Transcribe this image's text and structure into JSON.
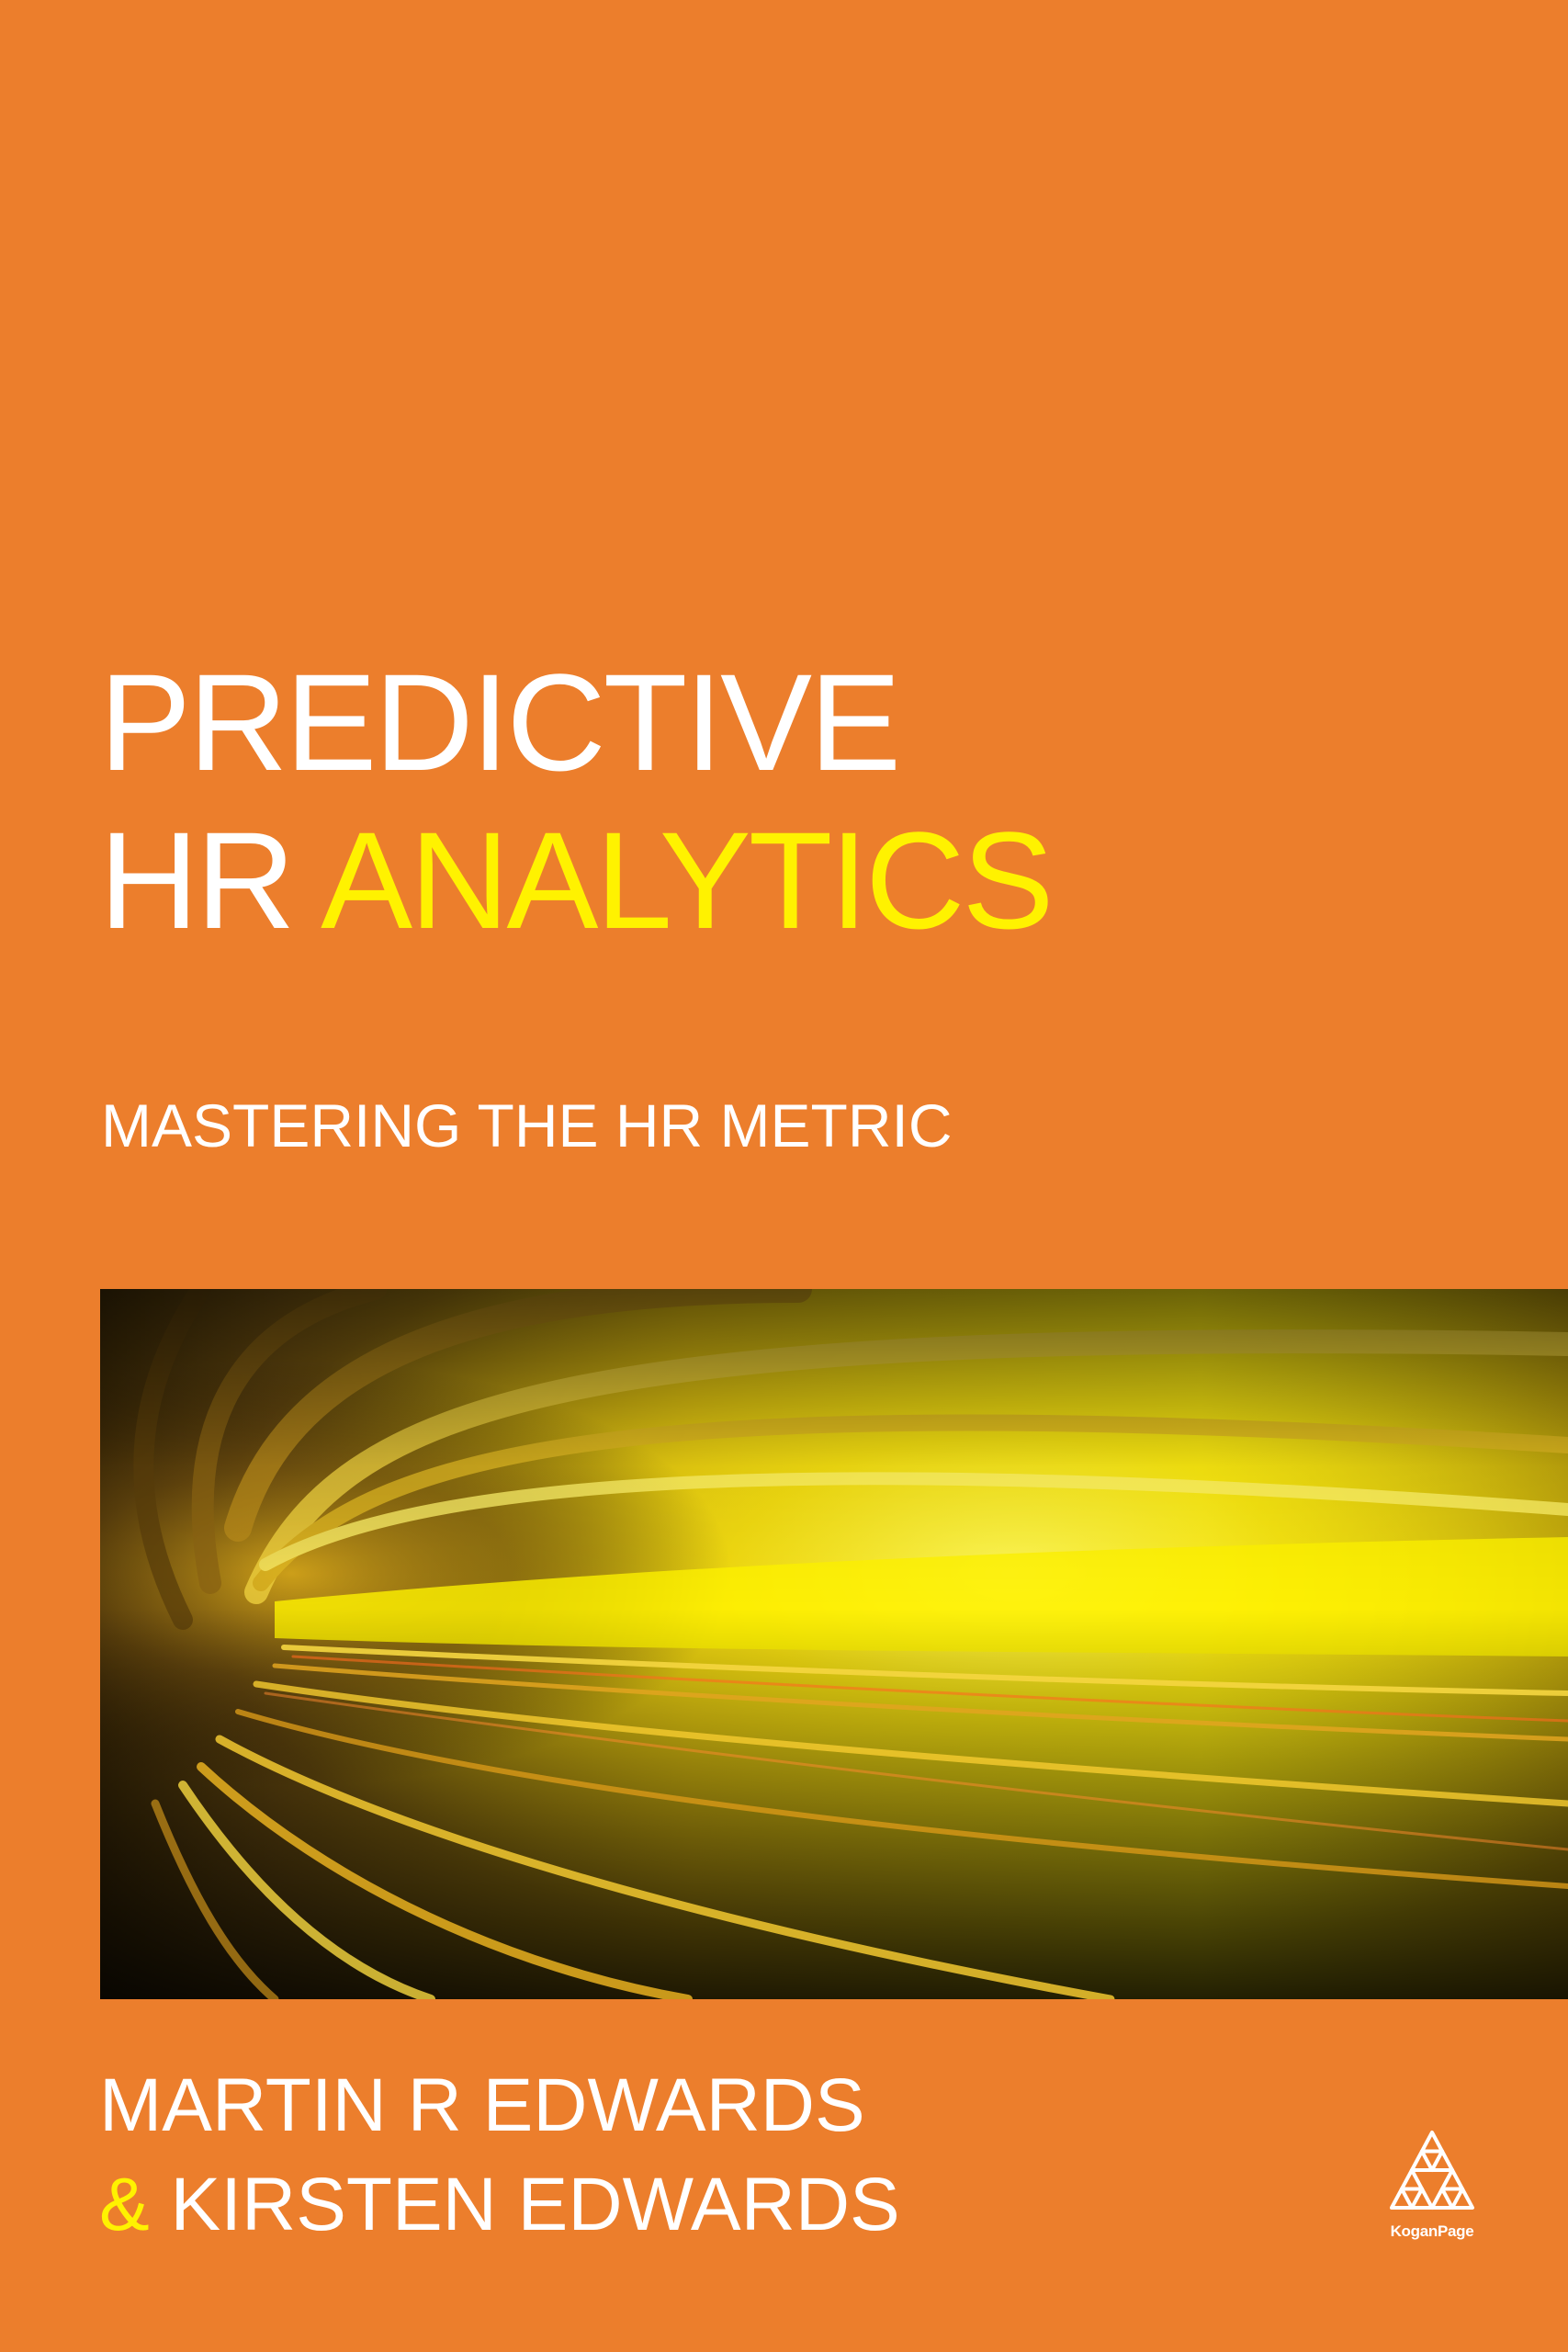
{
  "cover": {
    "title_line1": "PREDICTIVE",
    "title_line2_prefix": "HR",
    "title_line2_accent": "ANALYTICS",
    "subtitle": "MASTERING THE HR METRIC",
    "author1": "MARTIN R EDWARDS",
    "author2_amp": "&",
    "author2_name": "KIRSTEN EDWARDS",
    "publisher": "KoganPage"
  },
  "colors": {
    "background": "#ec7e2c",
    "title": "#ffffff",
    "accent": "#fff200"
  },
  "icons": {
    "publisher_logo": "triangle-of-triangles-logo",
    "cover_image": "light-speed-tunnel-image"
  }
}
